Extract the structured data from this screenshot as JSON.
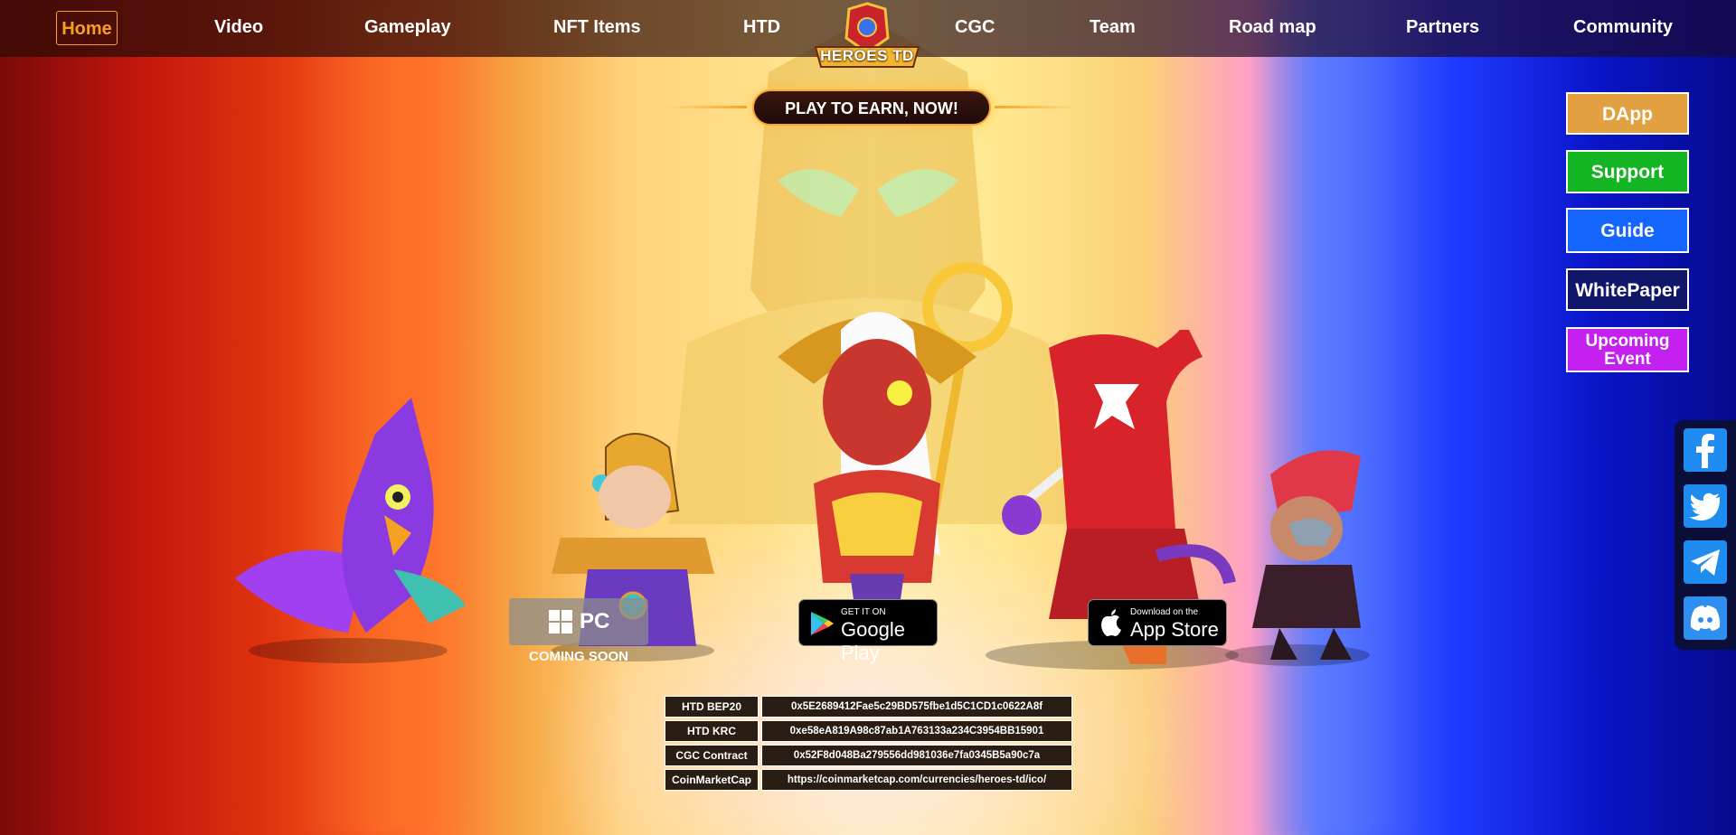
{
  "nav": {
    "home": "Home",
    "items": [
      "Video",
      "Gameplay",
      "NFT Items",
      "HTD",
      "CGC",
      "Team",
      "Road map",
      "Partners",
      "Community"
    ]
  },
  "logo": {
    "text": "HEROES TD"
  },
  "hero": {
    "banner": "PLAY TO EARN, NOW!"
  },
  "side_buttons": {
    "dapp": "DApp",
    "support": "Support",
    "guide": "Guide",
    "whitepaper": "WhitePaper",
    "event": "Upcoming Event"
  },
  "social": [
    "facebook-icon",
    "twitter-icon",
    "telegram-icon",
    "discord-icon"
  ],
  "downloads": {
    "pc": "PC",
    "pc_note": "COMING SOON",
    "google_small": "GET IT ON",
    "google_big": "Google Play",
    "apple_small": "Download on the",
    "apple_big": "App Store"
  },
  "contracts": [
    {
      "label": "HTD BEP20",
      "value": "0x5E2689412Fae5c29BD575fbe1d5C1CD1c0622A8f"
    },
    {
      "label": "HTD KRC",
      "value": "0xe58eA819A98c87ab1A763133a234C3954BB15901"
    },
    {
      "label": "CGC Contract",
      "value": "0x52F8d048Ba279556dd981036e7fa0345B5a90c7a"
    },
    {
      "label": "CoinMarketCap",
      "value": "https://coinmarketcap.com/currencies/heroes-td/ico/"
    }
  ],
  "colors": {
    "nav_accent": "#f5a020",
    "dapp": "#e2a040",
    "support": "#13b523",
    "guide": "#1466ff",
    "whitepaper": "#10166a",
    "event": "#c420f0"
  }
}
